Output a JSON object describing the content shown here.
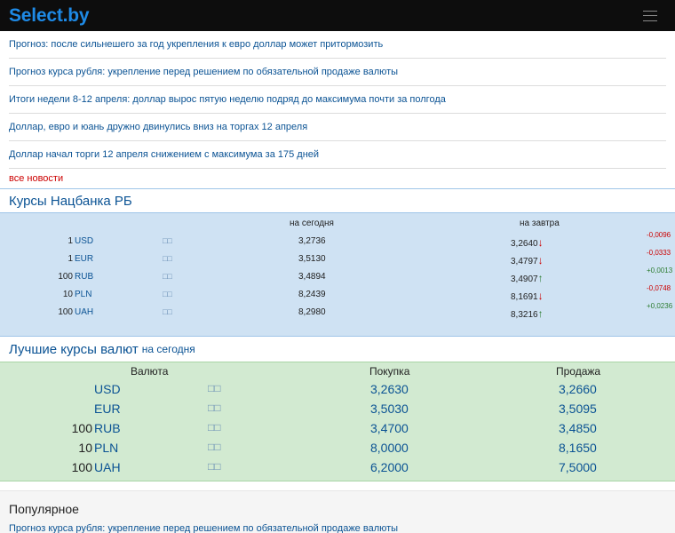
{
  "header": {
    "logo": "Select.by"
  },
  "news": {
    "items": [
      "Прогноз: после сильнешего за год укрепления к евро доллар может притормозить",
      "Прогноз курса рубля: укрепление перед решением по обязательной продаже валюты",
      "Итоги недели 8-12 апреля: доллар вырос пятую неделю подряд до максимума почти за полгода",
      "Доллар, евро и юань дружно двинулись вниз на торгах 12 апреля",
      "Доллар начал торги 12 апреля снижением с максимума за 175 дней"
    ],
    "all_news": "все новости"
  },
  "nbrb": {
    "title": "Курсы Нацбанка РБ",
    "col_today": "на сегодня",
    "col_tomorrow": "на завтра",
    "rows": [
      {
        "qty": "1",
        "currency": "USD",
        "flag": "□□",
        "today": "3,2736",
        "tomorrow": "3,2640",
        "arrow": "↓",
        "delta": "-0,0096"
      },
      {
        "qty": "1",
        "currency": "EUR",
        "flag": "□□",
        "today": "3,5130",
        "tomorrow": "3,4797",
        "arrow": "↓",
        "delta": "-0,0333"
      },
      {
        "qty": "100",
        "currency": "RUB",
        "flag": "□□",
        "today": "3,4894",
        "tomorrow": "3,4907",
        "arrow": "↑",
        "delta": "+0,0013"
      },
      {
        "qty": "10",
        "currency": "PLN",
        "flag": "□□",
        "today": "8,2439",
        "tomorrow": "8,1691",
        "arrow": "↓",
        "delta": "-0,0748"
      },
      {
        "qty": "100",
        "currency": "UAH",
        "flag": "□□",
        "today": "8,2980",
        "tomorrow": "8,3216",
        "arrow": "↑",
        "delta": "+0,0236"
      }
    ]
  },
  "best": {
    "title": "Лучшие курсы валют",
    "subtitle": "на сегодня",
    "col_currency": "Валюта",
    "col_buy": "Покупка",
    "col_sell": "Продажа",
    "rows": [
      {
        "qty": "",
        "currency": "USD",
        "flag": "□□",
        "buy": "3,2630",
        "sell": "3,2660"
      },
      {
        "qty": "",
        "currency": "EUR",
        "flag": "□□",
        "buy": "3,5030",
        "sell": "3,5095"
      },
      {
        "qty": "100",
        "currency": "RUB",
        "flag": "□□",
        "buy": "3,4700",
        "sell": "3,4850"
      },
      {
        "qty": "10",
        "currency": "PLN",
        "flag": "□□",
        "buy": "8,0000",
        "sell": "8,1650"
      },
      {
        "qty": "100",
        "currency": "UAH",
        "flag": "□□",
        "buy": "6,2000",
        "sell": "7,5000"
      }
    ]
  },
  "popular": {
    "title": "Популярное",
    "items": [
      "Прогноз курса рубля: укрепление перед решением по обязательной продаже валюты"
    ]
  }
}
